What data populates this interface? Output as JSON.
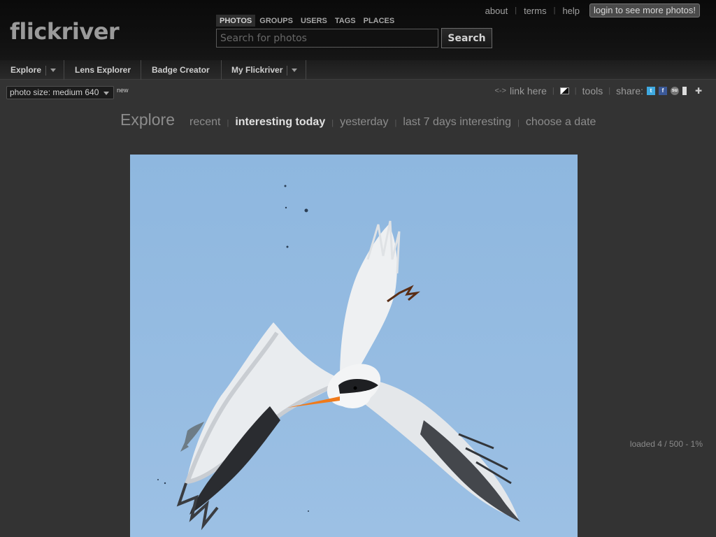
{
  "header": {
    "logo": "flickriver",
    "search_tabs": [
      {
        "label": "PHOTOS",
        "active": true
      },
      {
        "label": "GROUPS",
        "active": false
      },
      {
        "label": "USERS",
        "active": false
      },
      {
        "label": "TAGS",
        "active": false
      },
      {
        "label": "PLACES",
        "active": false
      }
    ],
    "search_placeholder": "Search for photos",
    "search_button": "Search",
    "links": [
      "about",
      "terms",
      "help"
    ],
    "login_button": "login to see more photos!"
  },
  "nav": {
    "items": [
      {
        "label": "Explore",
        "has_dropdown": true
      },
      {
        "label": "Lens Explorer",
        "has_dropdown": false
      },
      {
        "label": "Badge Creator",
        "has_dropdown": false
      },
      {
        "label": "My Flickriver",
        "has_dropdown": true
      }
    ]
  },
  "toolbar": {
    "photo_size": "photo size: medium 640",
    "new_badge": "new",
    "link_here": "link here",
    "tools": "tools",
    "share": "share:",
    "share_icons": [
      "twitter-icon",
      "facebook-icon",
      "stumbleupon-icon",
      "delicious-icon",
      "plugin-icon"
    ]
  },
  "explore": {
    "title": "Explore",
    "links": [
      {
        "label": "recent",
        "active": false
      },
      {
        "label": "interesting today",
        "active": true
      },
      {
        "label": "yesterday",
        "active": false
      },
      {
        "label": "last 7 days interesting",
        "active": false
      },
      {
        "label": "choose a date",
        "active": false
      }
    ]
  },
  "photo": {
    "subject": "diving-tern-photo"
  },
  "status": {
    "loaded": "loaded 4 / 500 - 1%"
  },
  "colors": {
    "background": "#333333",
    "header": "#111111",
    "sky": "#9cc0e4"
  }
}
